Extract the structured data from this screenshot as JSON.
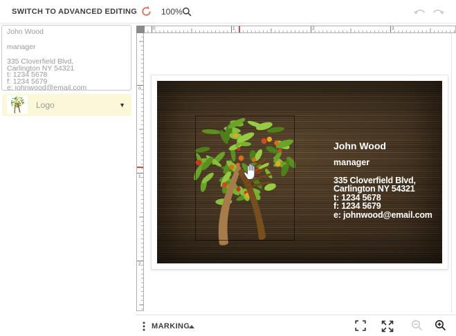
{
  "topbar": {
    "advanced_editing_label": "SWITCH TO ADVANCED EDITING",
    "zoom_level": "100%"
  },
  "contact": {
    "name": "John Wood",
    "title": "manager",
    "address_lines": [
      "335 Cloverfield Blvd,",
      "Carlington NY 54321",
      "t: 1234 5678",
      "f: 1234 5679",
      "e: johnwood@email.com"
    ]
  },
  "sidebar": {
    "logo_label": "Logo"
  },
  "rulers": {
    "horizontal_numbers": [
      "0",
      "1",
      "2",
      "3"
    ],
    "vertical_numbers": [
      "0",
      "1",
      "2"
    ]
  },
  "bottombar": {
    "marking_label": "MARKING"
  },
  "icons": {
    "topbar": [
      "refresh-icon",
      "magnifier-icon",
      "undo-icon",
      "redo-icon"
    ],
    "bottombar": [
      "kebab-icon",
      "caret-up-icon",
      "fullscreen-icon",
      "expand-icon",
      "zoom-out-icon",
      "zoom-in-icon"
    ]
  },
  "colors": {
    "accent_red": "#E0716B",
    "logo_row_bg": "#FBF8DA",
    "ruler_marker_red": "#E0493A",
    "card_wood_brown": "#46331F",
    "card_text": "#FFFFFF",
    "leaf_green": "#79B231"
  }
}
